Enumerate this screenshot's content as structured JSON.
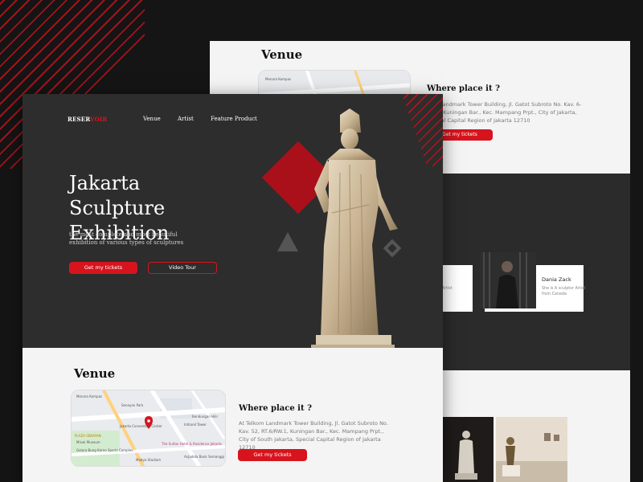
{
  "back_page": {
    "venue_title": "Venue",
    "where_title": "Where place it ?",
    "address": "kom Landmark Tower Building, Jl. Gatot Subroto No. Kav. 6-RW.1, Kuningan Bar., Kec. Mampang Prpt., City of Jakarta, Special Capital Region of Jakarta 12710",
    "button": "Get my tickets",
    "map_label": "Menara Kompas",
    "artists": [
      {
        "name": "mith",
        "desc": "ulptor Artist\nrica"
      },
      {
        "name": "Dania Zack",
        "desc": "She is A sculptor Artist\nfrom Canada"
      }
    ]
  },
  "front_page": {
    "logo_a": "RESER",
    "logo_b": "VOIR",
    "nav": [
      "Venue",
      "Artist",
      "Feature Product"
    ],
    "hero_title": "Jakarta Sculpture Exhibition",
    "hero_subtitle": "the most complete and most beautiful exhibition of various types of sculptures",
    "primary_button": "Get my tickets",
    "secondary_button": "Video Tour",
    "venue_title": "Venue",
    "where_title": "Where place it ?",
    "address": "At Telkom Landmark Tower Building, Jl. Gatot Subroto No. Kav. 52, RT.6/RW.1, Kuningan Bar., Kec. Mampang Prpt., City of South Jakarta, Special Capital Region of Jakarta 12710",
    "venue_button": "Get my tickets",
    "map_labels": {
      "kompas": "Menara Kompas",
      "senayan_park": "Senayan Park",
      "jakarta_convention": "Jakarta Convention Center",
      "plaza_senayan": "PLAZA SENAYAN",
      "misuk": "Misuk Museum",
      "sultan": "The Sultan Hotel & Residence Jakarta",
      "bung_karno": "Gelora Bung Karno Sports Complex",
      "madya": "Madya Stadium",
      "semanggi": "Anjadola Bank Semanggi",
      "tower": "Intiland Tower",
      "bendungan": "Bendungan Hilir"
    }
  },
  "colors": {
    "accent": "#d7141d",
    "dark": "#2d2d2d",
    "light": "#f4f4f4"
  }
}
